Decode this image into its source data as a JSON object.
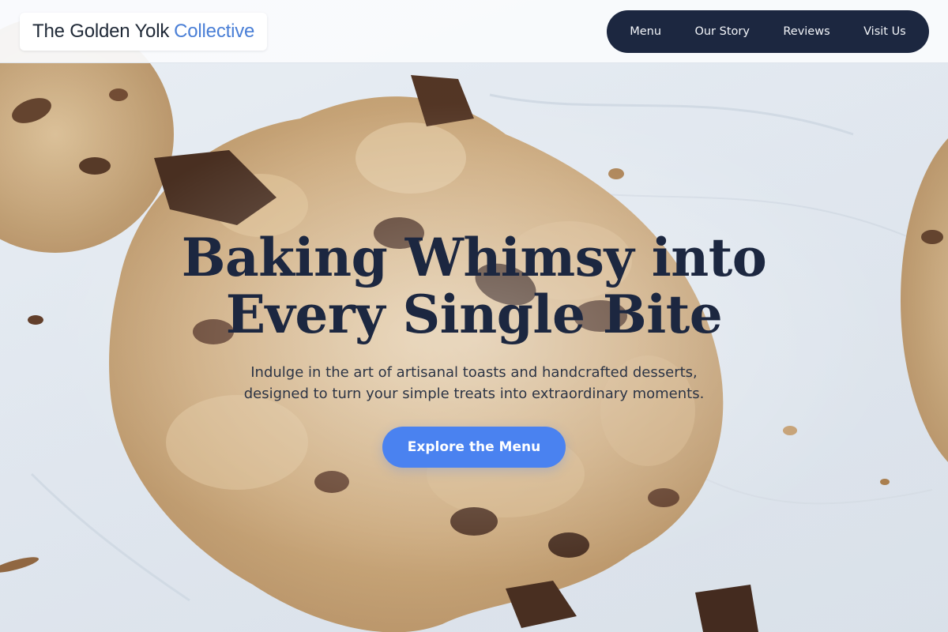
{
  "brand": {
    "name": "The Golden Yolk",
    "accent": "Collective",
    "accent_color": "#4a7fd6"
  },
  "nav": {
    "items": [
      {
        "label": "Menu"
      },
      {
        "label": "Our Story"
      },
      {
        "label": "Reviews"
      },
      {
        "label": "Visit Us"
      }
    ],
    "background_color": "#1c2740"
  },
  "hero": {
    "title_line_1": "Baking Whimsy into",
    "title_line_2": "Every Single Bite",
    "subtitle_line_1": "Indulge in the art of artisanal toasts and handcrafted desserts,",
    "subtitle_line_2": "designed to turn your simple treats into extraordinary moments.",
    "cta_label": "Explore the Menu",
    "cta_color": "#4a82f0",
    "background_image": "chocolate-chip-cookies-photo"
  }
}
